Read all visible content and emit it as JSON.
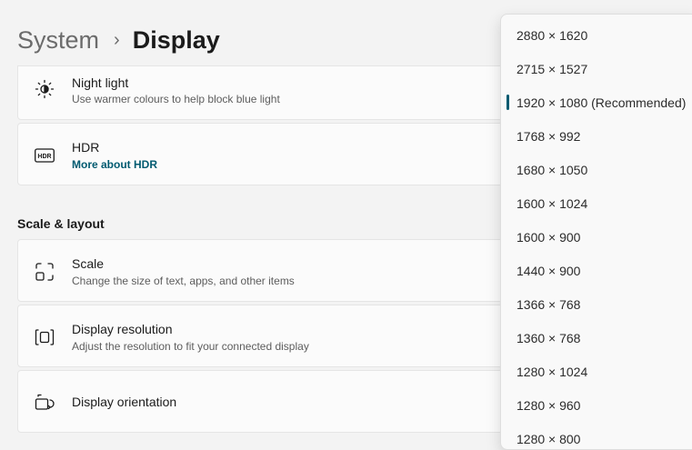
{
  "breadcrumb": {
    "parent": "System",
    "separator": "›",
    "current": "Display"
  },
  "cards": {
    "night_light": {
      "title": "Night light",
      "subtitle": "Use warmer colours to help block blue light",
      "icon": "brightness-icon"
    },
    "hdr": {
      "title": "HDR",
      "link": "More about HDR",
      "icon": "hdr-icon",
      "icon_text": "HDR"
    },
    "scale": {
      "title": "Scale",
      "subtitle": "Change the size of text, apps, and other items",
      "icon": "scale-icon"
    },
    "resolution": {
      "title": "Display resolution",
      "subtitle": "Adjust the resolution to fit your connected display",
      "icon": "resolution-icon"
    },
    "orientation": {
      "title": "Display orientation",
      "icon": "orientation-icon"
    }
  },
  "sections": {
    "scale_layout": "Scale & layout"
  },
  "resolution_dropdown": {
    "selected_index": 2,
    "options": [
      "2880 × 1620",
      "2715 × 1527",
      "1920 × 1080 (Recommended)",
      "1768 × 992",
      "1680 × 1050",
      "1600 × 1024",
      "1600 × 900",
      "1440 × 900",
      "1366 × 768",
      "1360 × 768",
      "1280 × 1024",
      "1280 × 960",
      "1280 × 800"
    ]
  },
  "colors": {
    "accent": "#005a70",
    "background": "#f3f3f3",
    "card": "#fbfbfb"
  }
}
